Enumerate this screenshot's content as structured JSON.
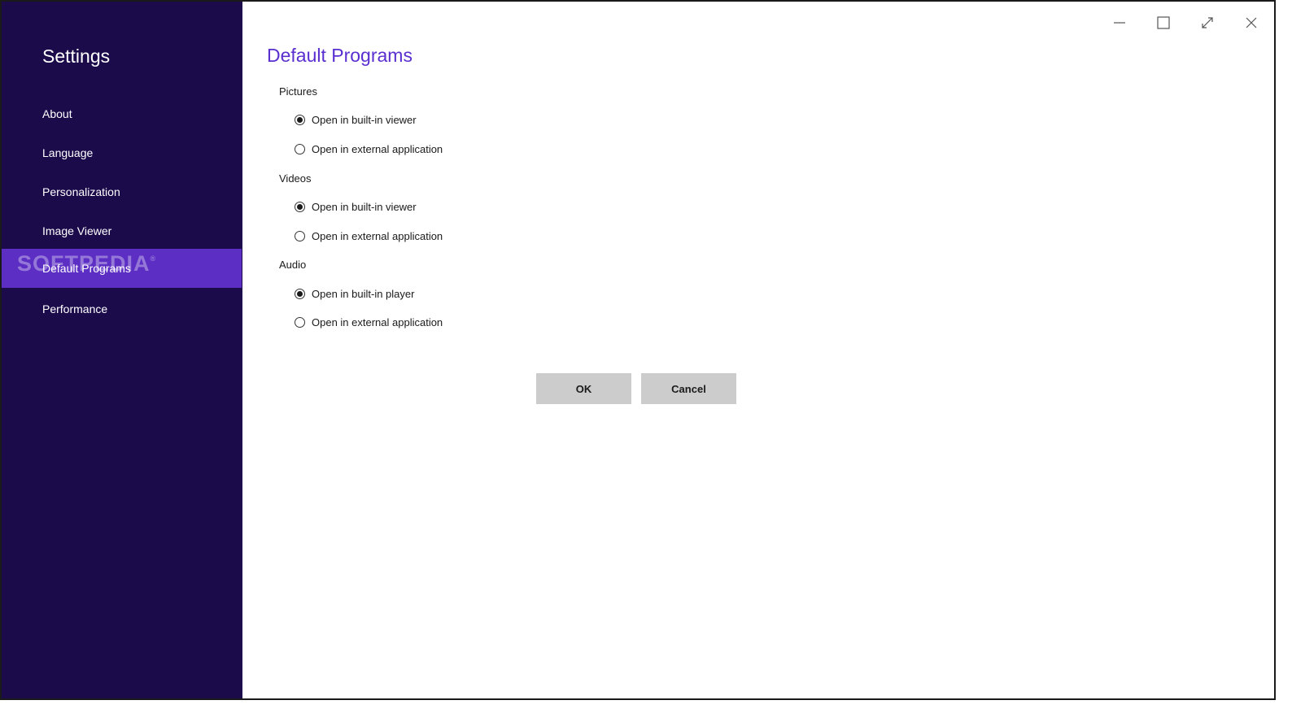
{
  "sidebar": {
    "title": "Settings",
    "items": [
      {
        "label": "About"
      },
      {
        "label": "Language"
      },
      {
        "label": "Personalization"
      },
      {
        "label": "Image Viewer"
      },
      {
        "label": "Default Programs",
        "active": true
      },
      {
        "label": "Performance"
      }
    ],
    "watermark": "SOFTPEDIA"
  },
  "main": {
    "title": "Default Programs",
    "groups": [
      {
        "label": "Pictures",
        "options": [
          {
            "label": "Open in built-in viewer",
            "checked": true
          },
          {
            "label": "Open in external application",
            "checked": false
          }
        ]
      },
      {
        "label": "Videos",
        "options": [
          {
            "label": "Open in built-in viewer",
            "checked": true
          },
          {
            "label": "Open in external application",
            "checked": false
          }
        ]
      },
      {
        "label": "Audio",
        "options": [
          {
            "label": "Open in built-in player",
            "checked": true
          },
          {
            "label": "Open in external application",
            "checked": false
          }
        ]
      }
    ],
    "ok_label": "OK",
    "cancel_label": "Cancel"
  },
  "window_controls": {
    "minimize": "minimize-icon",
    "maximize": "maximize-icon",
    "fullscreen": "fullscreen-icon",
    "close": "close-icon"
  },
  "colors": {
    "sidebar_bg": "#1b0b4b",
    "sidebar_active": "#5c2ec4",
    "title_accent": "#5a2fd0",
    "button_bg": "#cccccc"
  }
}
